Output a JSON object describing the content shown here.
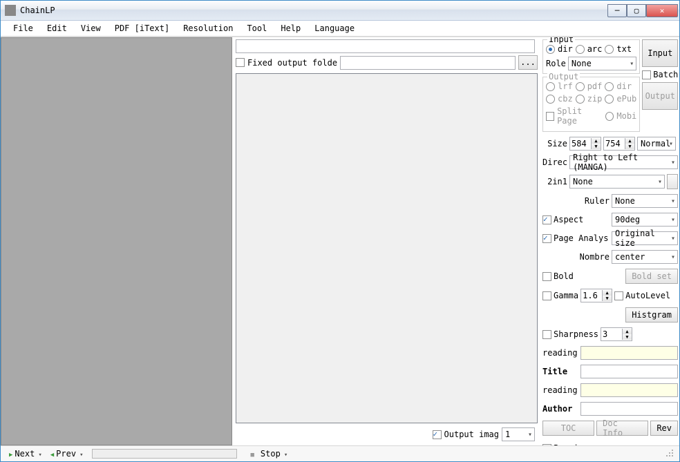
{
  "window": {
    "title": "ChainLP"
  },
  "menu": {
    "file": "File",
    "edit": "Edit",
    "view": "View",
    "pdf": "PDF [iText]",
    "resolution": "Resolution",
    "tool": "Tool",
    "help": "Help",
    "language": "Language"
  },
  "mid": {
    "fixed_output_label": "Fixed output folde",
    "dots": "...",
    "output_imag_label": "Output imag",
    "output_imag_value": "1"
  },
  "right": {
    "input_legend": "Input",
    "radios_input": {
      "dir": "dir",
      "arc": "arc",
      "txt": "txt"
    },
    "role_label": "Role",
    "role_value": "None",
    "output_legend": "Output",
    "radios_output": {
      "lrf": "lrf",
      "pdf": "pdf",
      "dir": "dir",
      "cbz": "cbz",
      "zip": "zip",
      "epub": "ePub"
    },
    "split_page": "Split Page",
    "mobi": "Mobi",
    "input_btn": "Input",
    "batch_label": "Batch",
    "output_btn": "Output",
    "size_label": "Size",
    "size_w": "584",
    "size_h": "754",
    "size_mode": "Normal",
    "direc_label": "Direc",
    "direc_value": "Right to Left (MANGA)",
    "twoin1_label": "2in1",
    "twoin1_value": "None",
    "ruler_label": "Ruler",
    "ruler_value": "None",
    "aspect_label": "Aspect",
    "aspect_value": "90deg",
    "page_analysis_label": "Page Analys",
    "page_analysis_value": "Original size",
    "nombre_label": "Nombre",
    "nombre_value": "center",
    "bold_label": "Bold",
    "bold_set_btn": "Bold set",
    "gamma_label": "Gamma",
    "gamma_value": "1.6",
    "autolevel_label": "AutoLevel",
    "histogram_btn": "Histgram",
    "sharpness_label": "Sharpness",
    "sharpness_value": "3",
    "reading1": "reading",
    "title_label": "Title",
    "reading2": "reading",
    "author_label": "Author",
    "toc_btn": "TOC",
    "docinfo_btn": "Doc Info",
    "rev_btn": "Rev",
    "preview_label": "Preview"
  },
  "status": {
    "next": "Next",
    "prev": "Prev",
    "stop": "Stop"
  }
}
